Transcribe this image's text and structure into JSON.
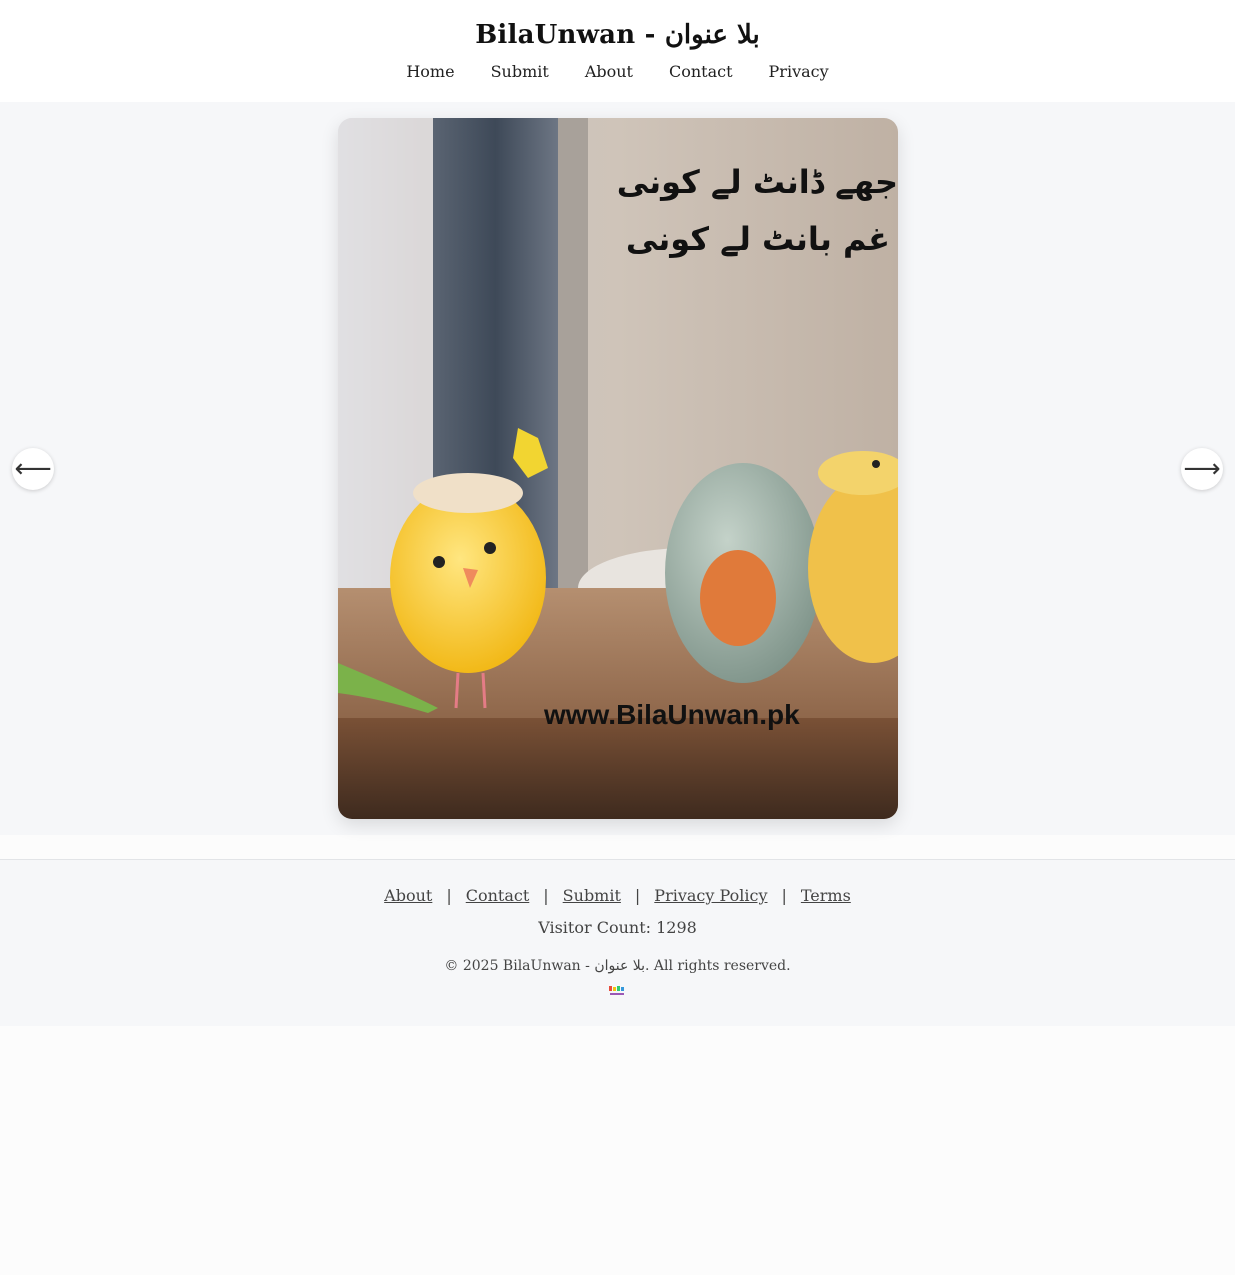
{
  "header": {
    "title": "BilaUnwan - بلا عنوان",
    "nav": [
      "Home",
      "Submit",
      "About",
      "Contact",
      "Privacy"
    ]
  },
  "slider": {
    "prev_arrow": "⟵",
    "next_arrow": "⟶",
    "image": {
      "urdu_line_1": "جھے ڈانٹ لے کونی",
      "urdu_line_2": "غم بانٹ لے کونی",
      "watermark": "www.BilaUnwan.pk"
    }
  },
  "footer": {
    "links": [
      "About",
      "Contact",
      "Submit",
      "Privacy Policy",
      "Terms"
    ],
    "separator": "|",
    "visitor_count": "Visitor Count: 1298",
    "copyright": "© 2025 BilaUnwan - بلا عنوان. All rights reserved."
  },
  "colors": {
    "page_bg": "#fcfcfc",
    "section_bg": "#f6f7f9",
    "text": "#222222"
  }
}
